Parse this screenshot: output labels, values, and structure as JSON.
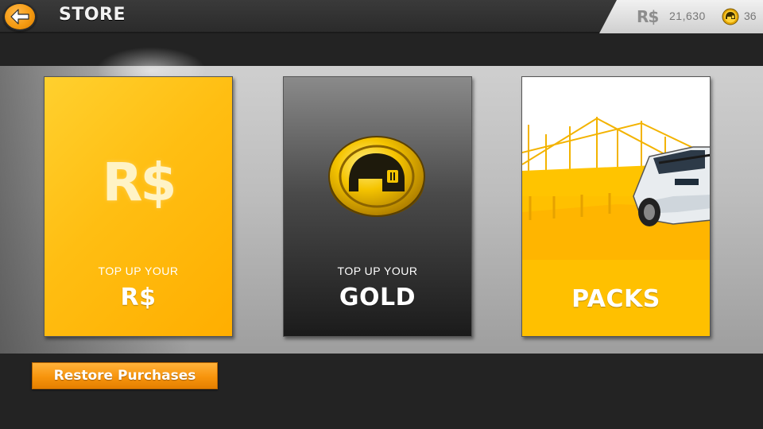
{
  "header": {
    "title": "STORE",
    "back_icon": "arrow-left-icon",
    "currency": {
      "rs_symbol": "R$",
      "rs_amount": "21,630",
      "gold_icon": "gold-helmet-coin-icon",
      "gold_amount": "36"
    }
  },
  "cards": [
    {
      "id": "rs",
      "symbol": "R$",
      "subtitle": "TOP UP YOUR",
      "label": "R$"
    },
    {
      "id": "gold",
      "icon": "gold-helmet-coin-icon",
      "subtitle": "TOP UP YOUR",
      "label": "GOLD"
    },
    {
      "id": "packs",
      "label": "PACKS"
    }
  ],
  "footer": {
    "restore_label": "Restore Purchases"
  },
  "colors": {
    "accent_orange": "#f7940c",
    "rs_card_yellow": "#ffbe12",
    "gold": "#f2b400"
  }
}
